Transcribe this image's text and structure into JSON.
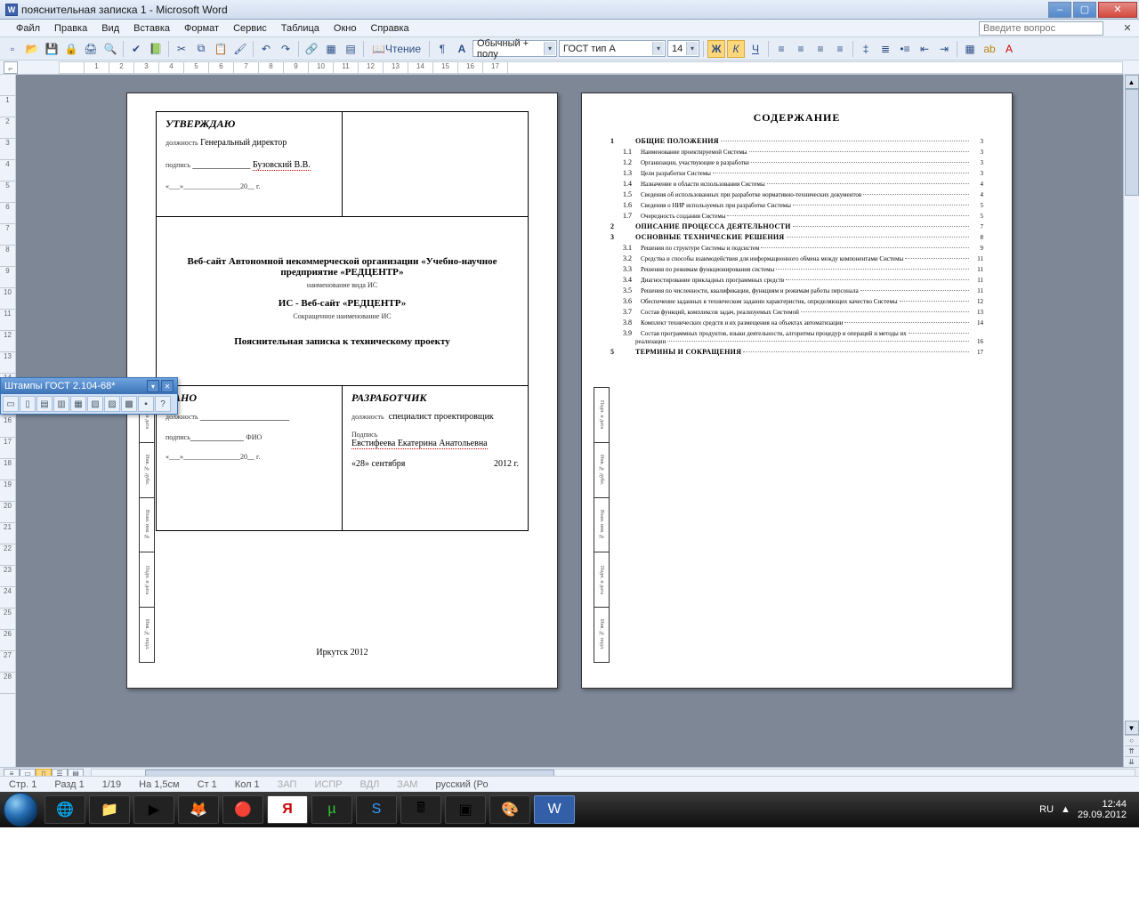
{
  "window": {
    "title": "пояснительная записка 1 - Microsoft Word"
  },
  "menu": {
    "items": [
      "Файл",
      "Правка",
      "Вид",
      "Вставка",
      "Формат",
      "Сервис",
      "Таблица",
      "Окно",
      "Справка"
    ]
  },
  "help_box": {
    "placeholder": "Введите вопрос"
  },
  "toolbar": {
    "reading_label": "Чтение",
    "style": "Обычный + полу",
    "font": "ГОСТ тип А",
    "size": "14",
    "bold": "Ж",
    "italic": "К",
    "underline": "Ч"
  },
  "ruler_ticks": [
    "",
    "1",
    "2",
    "3",
    "4",
    "5",
    "6",
    "7",
    "8",
    "9",
    "10",
    "11",
    "12",
    "13",
    "14",
    "15",
    "16",
    "17"
  ],
  "vruler_ticks": [
    "",
    "1",
    "2",
    "3",
    "4",
    "5",
    "6",
    "7",
    "8",
    "9",
    "10",
    "11",
    "12",
    "13",
    "14",
    "15",
    "16",
    "17",
    "18",
    "19",
    "20",
    "21",
    "22",
    "23",
    "24",
    "25",
    "26",
    "27",
    "28"
  ],
  "page1": {
    "approve": {
      "hdr": "УТВЕРЖДАЮ",
      "position_lbl": "должность",
      "position": "Генеральный директор",
      "sign_lbl": "подпись",
      "name": "Бузовский В.В.",
      "date": "«___»________________20__ г."
    },
    "title1": "Веб-сайт Автономной некоммерческой организации «Учебно-научное предприятие «РЕДЦЕНТР»",
    "subtitle1": "наименование вида ИС",
    "title2": "ИС - Веб-сайт «РЕДЦЕНТР»",
    "subtitle2": "Сокращенное наименование ИС",
    "doc_title": "Пояснительная записка к техническому проекту",
    "agree": {
      "hdr": "...АНО",
      "position_lbl": "должность",
      "sign_lbl": "подпись",
      "fio_lbl": "ФИО",
      "date": "«___»________________20__ г."
    },
    "dev": {
      "hdr": "РАЗРАБОТЧИК",
      "position_lbl": "должность",
      "position": "специалист проектировщик",
      "sign_lbl": "Подпись",
      "name": "Евстифеева Екатерина Анатольевна",
      "date_l": "«28» сентября",
      "date_r": "2012 г."
    },
    "footer": "Иркутск  2012",
    "stamp_cells": [
      "Подп. и дата",
      "Инв. № дубл.",
      "Взам. инв. №",
      "Подп. и дата",
      "Инв. № подл."
    ]
  },
  "page2": {
    "heading": "СОДЕРЖАНИЕ",
    "toc": [
      {
        "n": "1",
        "t": "ОБЩИЕ ПОЛОЖЕНИЯ",
        "p": "3",
        "b": true
      },
      {
        "n": "1.1",
        "t": "Наименование проектируемой Системы",
        "p": "3"
      },
      {
        "n": "1.2",
        "t": "Организации, участвующие в разработке",
        "p": "3"
      },
      {
        "n": "1.3",
        "t": "Цели разработки Системы",
        "p": "3"
      },
      {
        "n": "1.4",
        "t": "Назначение и области использования Системы",
        "p": "4"
      },
      {
        "n": "1.5",
        "t": "Сведения об использованных при разработке нормативно-технических документов",
        "p": "4"
      },
      {
        "n": "1.6",
        "t": "Сведения о НИР используемых при разработке Системы",
        "p": "5"
      },
      {
        "n": "1.7",
        "t": "Очередность создания Системы",
        "p": "5"
      },
      {
        "n": "2",
        "t": "ОПИСАНИЕ ПРОЦЕССА ДЕЯТЕЛЬНОСТИ",
        "p": "7",
        "b": true
      },
      {
        "n": "3",
        "t": "ОСНОВНЫЕ ТЕХНИЧЕСКИЕ РЕШЕНИЯ",
        "p": "8",
        "b": true
      },
      {
        "n": "3.1",
        "t": "Решения по структуре Системы и подсистем",
        "p": "9"
      },
      {
        "n": "3.2",
        "t": "Средства и способы взаимодействия для информационного обмена между компонентами Системы",
        "p": "11"
      },
      {
        "n": "3.3",
        "t": "Решения по режимам функционирования системы",
        "p": "11"
      },
      {
        "n": "3.4",
        "t": "Диагностирование прикладных программных средств",
        "p": "11"
      },
      {
        "n": "3.5",
        "t": "Решения по численности, квалификации, функциям и режимам работы персонала",
        "p": "11"
      },
      {
        "n": "3.6",
        "t": "Обеспечение заданных в техническом задании характеристик, определяющих качество Системы",
        "p": "12"
      },
      {
        "n": "3.7",
        "t": "Состав функций, комплексов задач, реализуемых Системой",
        "p": "13"
      },
      {
        "n": "3.8",
        "t": "Комплект технических средств и их размещения на объектах автоматизации",
        "p": "14"
      },
      {
        "n": "3.9",
        "t": "Состав программных продуктов, языки деятельности, алгоритмы процедур и операций и методы их",
        "p": ""
      },
      {
        "n": "",
        "t": "реализации",
        "p": "16",
        "cont": true
      },
      {
        "n": "5",
        "t": "ТЕРМИНЫ И СОКРАЩЕНИЯ",
        "p": "17",
        "b": true
      }
    ]
  },
  "stamp_palette": {
    "title": "Штампы ГОСТ 2.104-68*"
  },
  "status": {
    "page_lbl": "Стр. 1",
    "section": "Разд 1",
    "pages": "1/19",
    "at": "На 1,5см",
    "line": "Ст 1",
    "col": "Кол 1",
    "rec": "ЗАП",
    "trk": "ИСПР",
    "ext": "ВДЛ",
    "ovr": "ЗАМ",
    "lang": "русский (Ро"
  },
  "tray": {
    "lang": "RU",
    "time": "12:44",
    "date": "29.09.2012"
  }
}
